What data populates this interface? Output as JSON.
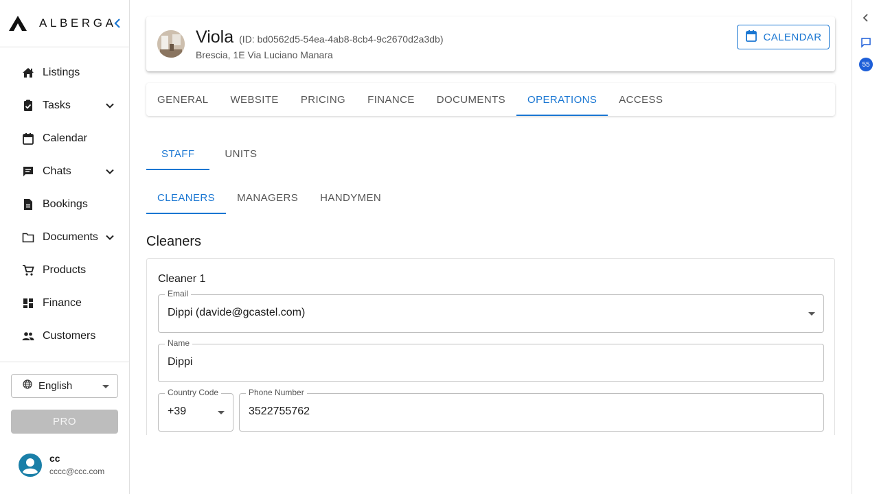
{
  "brand": {
    "name": "ALBERGA"
  },
  "sidebar": {
    "items": [
      {
        "label": "Listings",
        "icon": "house-icon"
      },
      {
        "label": "Tasks",
        "icon": "task-icon",
        "expandable": true
      },
      {
        "label": "Calendar",
        "icon": "calendar-icon"
      },
      {
        "label": "Chats",
        "icon": "chat-icon",
        "expandable": true
      },
      {
        "label": "Bookings",
        "icon": "document-icon"
      },
      {
        "label": "Documents",
        "icon": "folder-icon",
        "expandable": true
      },
      {
        "label": "Products",
        "icon": "cart-icon"
      },
      {
        "label": "Finance",
        "icon": "dashboard-icon"
      },
      {
        "label": "Customers",
        "icon": "people-icon"
      }
    ],
    "language": "English",
    "pro_label": "PRO",
    "user": {
      "name": "cc",
      "email": "cccc@ccc.com"
    }
  },
  "property": {
    "name": "Viola",
    "id_text": "(ID: bd0562d5-54ea-4ab8-8cb4-9c2670d2a3db)",
    "address": "Brescia, 1E Via Luciano Manara",
    "calendar_label": "CALENDAR"
  },
  "tabs": {
    "items": [
      "GENERAL",
      "WEBSITE",
      "PRICING",
      "FINANCE",
      "DOCUMENTS",
      "OPERATIONS",
      "ACCESS"
    ],
    "active": "OPERATIONS"
  },
  "subtabs": {
    "items": [
      "STAFF",
      "UNITS"
    ],
    "active": "STAFF"
  },
  "staff_tabs": {
    "items": [
      "CLEANERS",
      "MANAGERS",
      "HANDYMEN"
    ],
    "active": "CLEANERS"
  },
  "section": {
    "title": "Cleaners"
  },
  "cleaner": {
    "title": "Cleaner 1",
    "email_label": "Email",
    "email_value": "Dippi (davide@gcastel.com)",
    "name_label": "Name",
    "name_value": "Dippi",
    "country_label": "Country Code",
    "country_value": "+39",
    "phone_label": "Phone Number",
    "phone_value": "3522755762"
  },
  "rail": {
    "badge": "55"
  },
  "colors": {
    "accent": "#1976d2",
    "badge": "#1e5fd8",
    "pro_disabled": "#bdbdbd"
  }
}
